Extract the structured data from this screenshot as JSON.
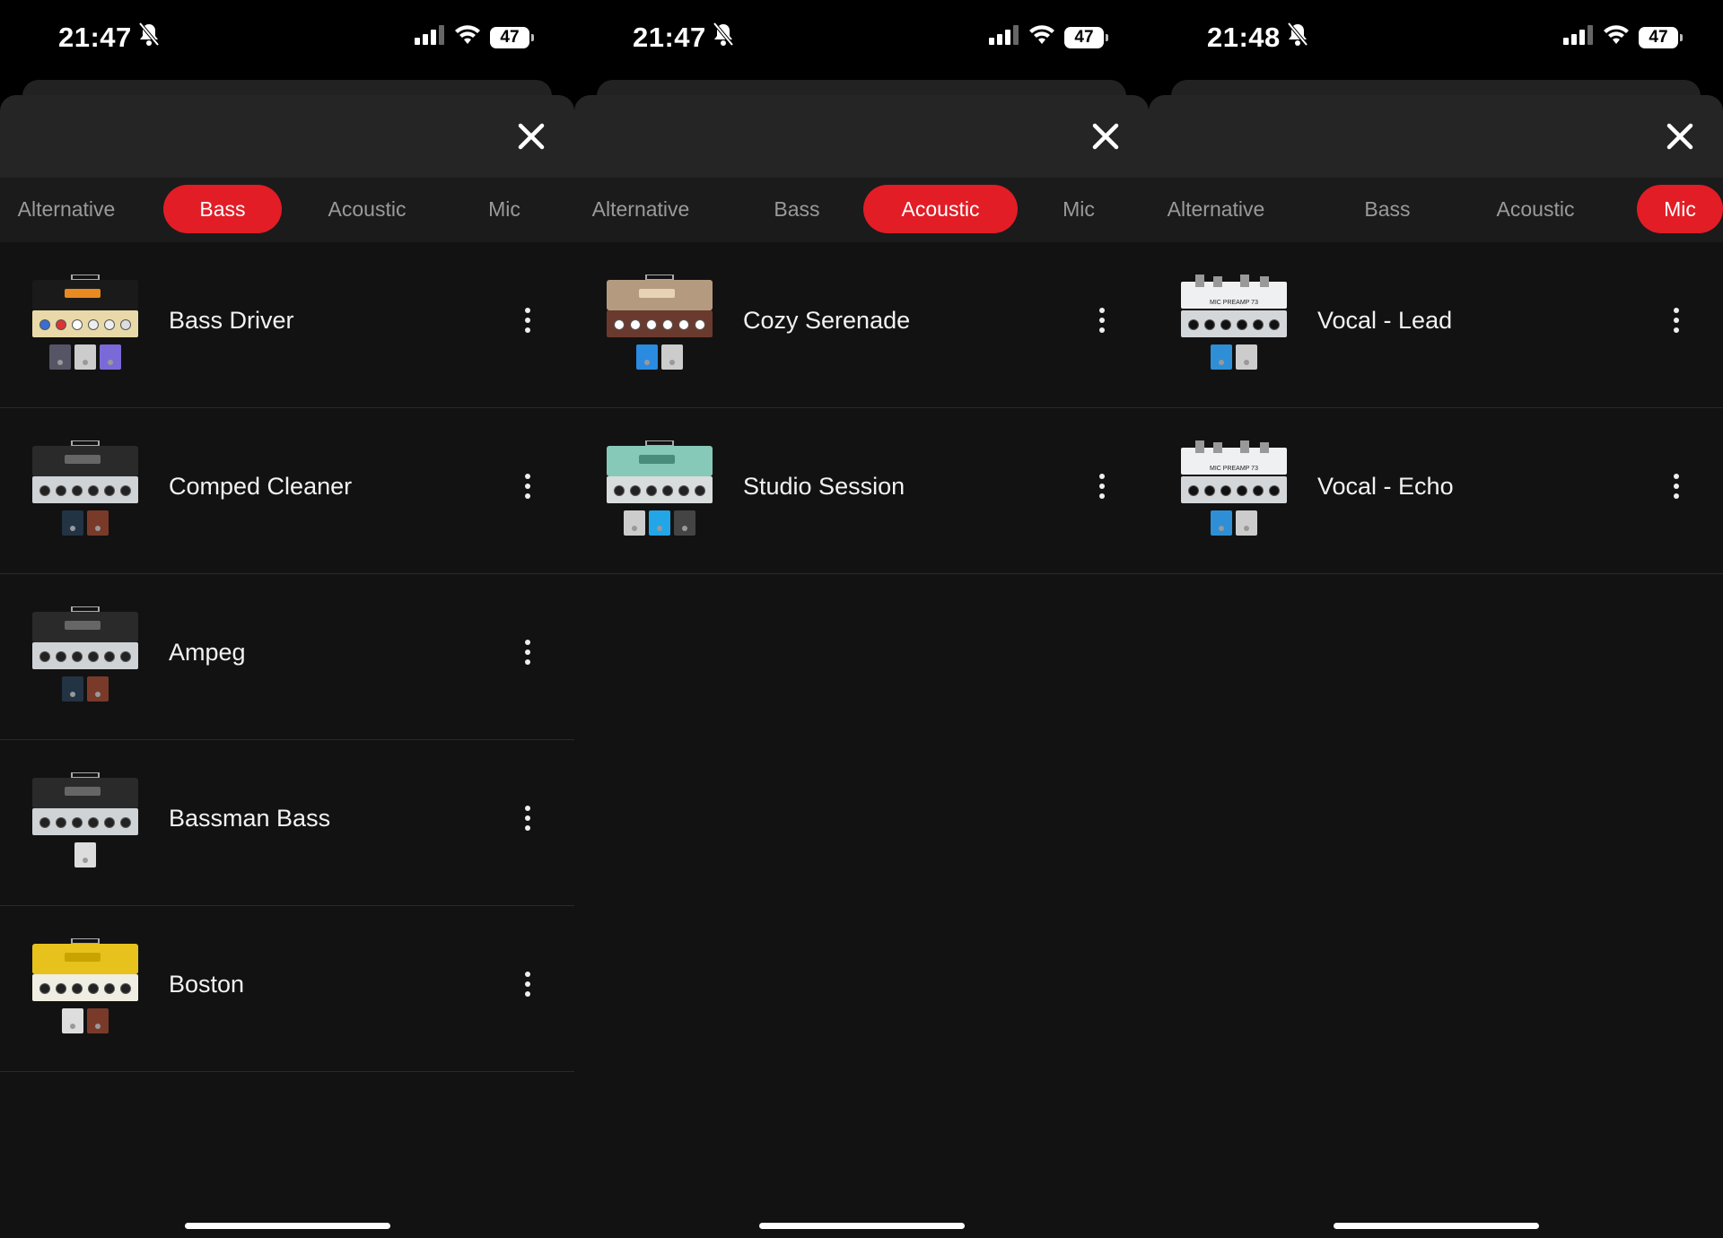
{
  "screens": [
    {
      "time": "21:47",
      "battery": "47",
      "tabs": [
        "Alternative",
        "Bass",
        "Acoustic",
        "Mic"
      ],
      "active_tab": "Bass",
      "presets": [
        "Bass Driver",
        "Comped Cleaner",
        "Ampeg",
        "Bassman Bass",
        "Boston"
      ]
    },
    {
      "time": "21:47",
      "battery": "47",
      "tabs": [
        "Alternative",
        "Bass",
        "Acoustic",
        "Mic"
      ],
      "active_tab": "Acoustic",
      "presets": [
        "Cozy Serenade",
        "Studio Session"
      ]
    },
    {
      "time": "21:48",
      "battery": "47",
      "tabs": [
        "Alternative",
        "Bass",
        "Acoustic",
        "Mic"
      ],
      "active_tab": "Mic",
      "presets": [
        "Vocal - Lead",
        "Vocal - Echo"
      ]
    }
  ],
  "colors": {
    "accent": "#e21d26",
    "background": "#121212",
    "header": "#252525",
    "tab_bar": "#1b1b1b"
  },
  "icons": [
    "bell-off-icon",
    "signal-icon",
    "wifi-icon",
    "battery-icon",
    "close-icon",
    "more-vertical-icon",
    "amp-thumbnail"
  ]
}
